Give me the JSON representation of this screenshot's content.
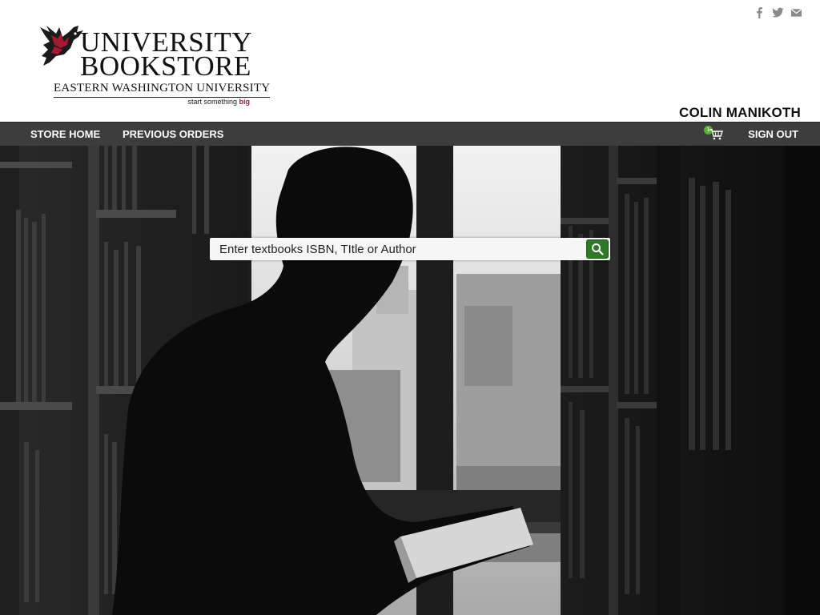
{
  "brand": {
    "title_line1": "University",
    "title_line2": "Bookstore",
    "subtitle": "Eastern Washington University",
    "tagline_prefix": "start something ",
    "tagline_emphasis": "big",
    "accent_color": "#a6192e"
  },
  "social": {
    "icons": [
      "facebook-icon",
      "twitter-icon",
      "mail-icon"
    ]
  },
  "user": {
    "name": "COLIN MANIKOTH"
  },
  "nav": {
    "store_home": "STORE HOME",
    "previous_orders": "PREVIOUS ORDERS",
    "sign_out": "SIGN OUT",
    "cart_count": "1",
    "cart_icon": "cart-icon"
  },
  "search": {
    "placeholder": "Enter textbooks ISBN, TItle or Author",
    "button_icon": "search-icon",
    "button_color": "#2c7a24"
  },
  "colors": {
    "navbar": "#3d3d3d",
    "cart_badge": "#59b22f"
  }
}
